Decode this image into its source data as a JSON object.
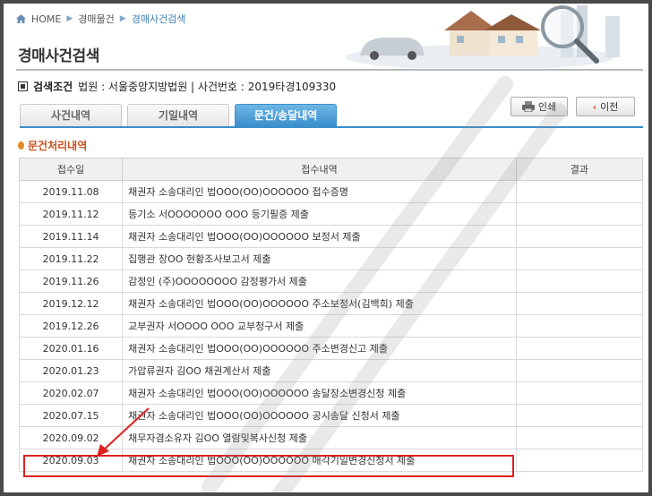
{
  "breadcrumb": {
    "home": "HOME",
    "level1": "경매물건",
    "level2": "경매사건검색"
  },
  "page_title": "경매사건검색",
  "condition": {
    "label": "검색조건",
    "text": "법원 : 서울중앙지방법원 | 사건번호 : 2019타경109330"
  },
  "tabs": [
    {
      "label": "사건내역"
    },
    {
      "label": "기일내역"
    },
    {
      "label": "문건/송달내역"
    }
  ],
  "buttons": {
    "print": "인쇄",
    "back": "이전"
  },
  "section_title": "문건처리내역",
  "table": {
    "headers": [
      "접수일",
      "접수내역",
      "결과"
    ],
    "rows": [
      {
        "date": "2019.11.08",
        "content": "채권자 소송대리인 법OOO(OO)OOOOOO 접수증명",
        "result": ""
      },
      {
        "date": "2019.11.12",
        "content": "등기소 서OOOOOOO OOO 등기필증 제출",
        "result": ""
      },
      {
        "date": "2019.11.14",
        "content": "채권자 소송대리인 법OOO(OO)OOOOOO 보정서 제출",
        "result": ""
      },
      {
        "date": "2019.11.22",
        "content": "집행관 장OO 현황조사보고서 제출",
        "result": ""
      },
      {
        "date": "2019.11.26",
        "content": "감정인 (주)OOOOOOOO 감정평가서 제출",
        "result": ""
      },
      {
        "date": "2019.12.12",
        "content": "채권자 소송대리인 법OOO(OO)OOOOOO 주소보정서(김백희) 제출",
        "result": ""
      },
      {
        "date": "2019.12.26",
        "content": "교부권자 서OOOO OOO 교부청구서 제출",
        "result": ""
      },
      {
        "date": "2020.01.16",
        "content": "채권자 소송대리인 법OOO(OO)OOOOOO 주소변경신고 제출",
        "result": ""
      },
      {
        "date": "2020.01.23",
        "content": "가압류권자 김OO 채권계산서 제출",
        "result": ""
      },
      {
        "date": "2020.02.07",
        "content": "채권자 소송대리인 법OOO(OO)OOOOOO 송달장소변경신청 제출",
        "result": ""
      },
      {
        "date": "2020.07.15",
        "content": "채권자 소송대리인 법OOO(OO)OOOOOO 공시송달 신청서 제출",
        "result": ""
      },
      {
        "date": "2020.09.02",
        "content": "채무자겸소유자 김OO 열람및복사신청 제출",
        "result": ""
      },
      {
        "date": "2020.09.03",
        "content": "채권자 소송대리인 법OOO(OO)OOOOOO 매각기일변경신청서 제출",
        "result": ""
      }
    ]
  },
  "colors": {
    "accent": "#3a8fcc",
    "section": "#c8501e",
    "highlight": "#e02020"
  }
}
